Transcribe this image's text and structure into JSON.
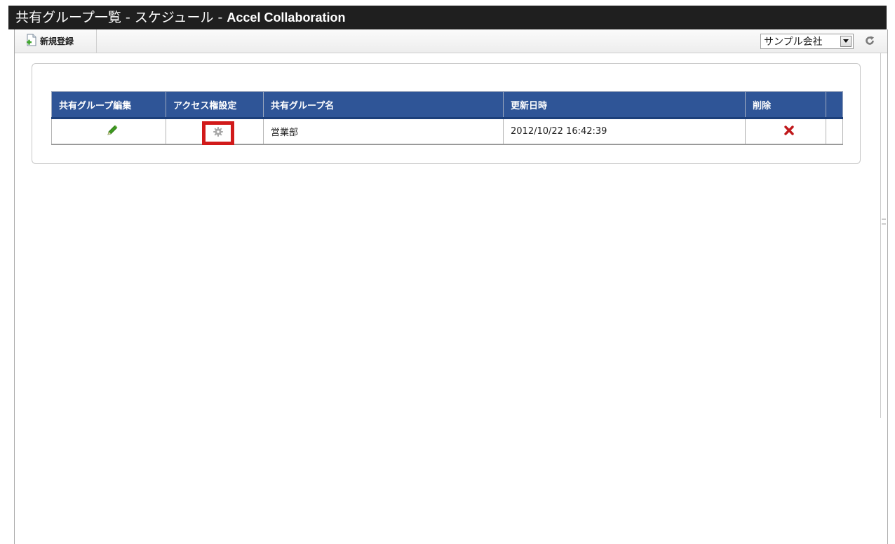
{
  "window": {
    "title_prefix": "共有グループ一覧 - スケジュール - ",
    "title_app": "Accel Collaboration"
  },
  "toolbar": {
    "new_label": "新規登録",
    "company_select": {
      "selected": "サンプル会社"
    }
  },
  "table": {
    "headers": [
      "共有グループ編集",
      "アクセス権設定",
      "共有グループ名",
      "更新日時",
      "削除"
    ],
    "rows": [
      {
        "name": "営業部",
        "updated": "2012/10/22 16:42:39"
      }
    ]
  },
  "icons": {
    "new": "new-document-icon",
    "edit": "pencil-icon",
    "access": "gear-icon",
    "delete": "delete-x-icon",
    "refresh": "refresh-icon"
  },
  "colors": {
    "header_bg": "#2f5597",
    "highlight": "#d11a1a",
    "delete": "#c0181b",
    "pencil": "#3d9a1f"
  }
}
